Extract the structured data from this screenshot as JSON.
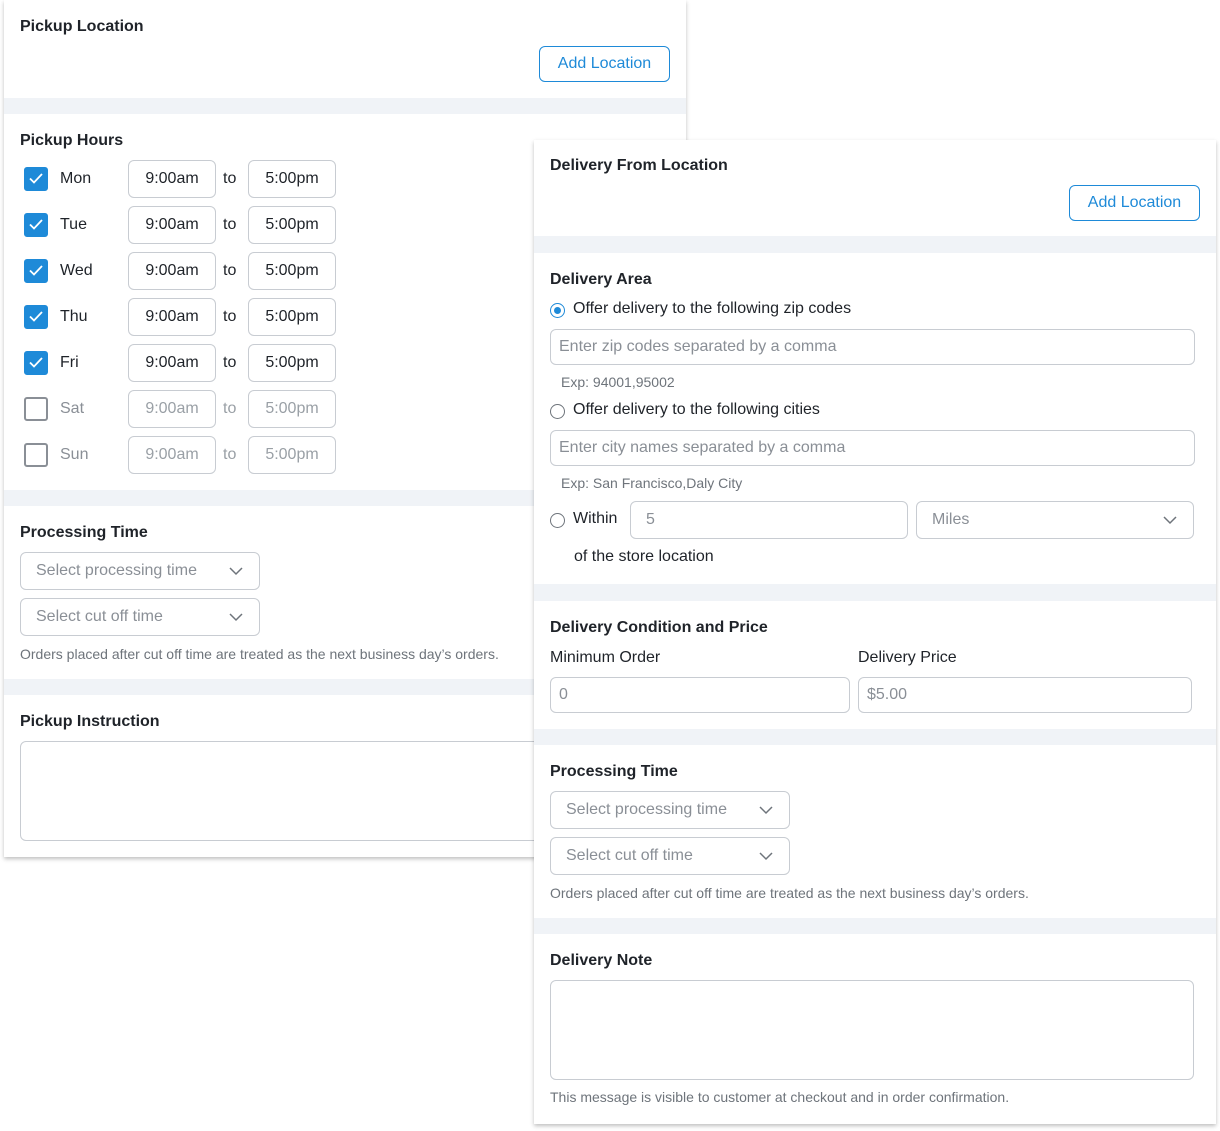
{
  "pickup": {
    "location": {
      "title": "Pickup Location",
      "add_button": "Add Location"
    },
    "hours": {
      "title": "Pickup Hours",
      "to_label": "to",
      "days": [
        {
          "name": "Mon",
          "checked": true,
          "open": "9:00am",
          "close": "5:00pm"
        },
        {
          "name": "Tue",
          "checked": true,
          "open": "9:00am",
          "close": "5:00pm"
        },
        {
          "name": "Wed",
          "checked": true,
          "open": "9:00am",
          "close": "5:00pm"
        },
        {
          "name": "Thu",
          "checked": true,
          "open": "9:00am",
          "close": "5:00pm"
        },
        {
          "name": "Fri",
          "checked": true,
          "open": "9:00am",
          "close": "5:00pm"
        },
        {
          "name": "Sat",
          "checked": false,
          "open": "9:00am",
          "close": "5:00pm"
        },
        {
          "name": "Sun",
          "checked": false,
          "open": "9:00am",
          "close": "5:00pm"
        }
      ]
    },
    "processing": {
      "title": "Processing Time",
      "processing_placeholder": "Select processing time",
      "cutoff_placeholder": "Select cut off time",
      "hint": "Orders placed after cut off time are treated as the  next business day’s orders."
    },
    "instruction": {
      "title": "Pickup Instruction",
      "value": ""
    }
  },
  "delivery": {
    "location": {
      "title": "Delivery From Location",
      "add_button": "Add Location"
    },
    "area": {
      "title": "Delivery Area",
      "zip_option": "Offer delivery to the following zip codes",
      "zip_placeholder": "Enter zip codes separated by a comma",
      "zip_example": "Exp: 94001,95002",
      "city_option": "Offer delivery to the following cities",
      "city_placeholder": "Enter city names separated by a comma",
      "city_example": "Exp: San Francisco,Daly City",
      "within_label": "Within",
      "within_value": "5",
      "unit_selected": "Miles",
      "of_store": "of  the store location",
      "selected_option": "zip"
    },
    "condition": {
      "title": "Delivery Condition and Price",
      "min_order_label": "Minimum Order",
      "min_order_value": "0",
      "price_label": "Delivery Price",
      "price_value": "$5.00"
    },
    "processing": {
      "title": "Processing Time",
      "processing_placeholder": "Select processing time",
      "cutoff_placeholder": "Select cut off time",
      "hint": "Orders placed after cut off time are treated as the  next business day’s orders."
    },
    "note": {
      "title": "Delivery Note",
      "value": "",
      "hint": "This message is visible to customer at checkout and in order confirmation."
    }
  },
  "colors": {
    "accent": "#1e8ad8",
    "panel_bg": "#f0f3f7",
    "border": "#c8ccd2",
    "muted": "#8a8f96"
  },
  "icons": {
    "checkbox_checked": "check-icon",
    "dropdown": "chevron-down-icon"
  }
}
